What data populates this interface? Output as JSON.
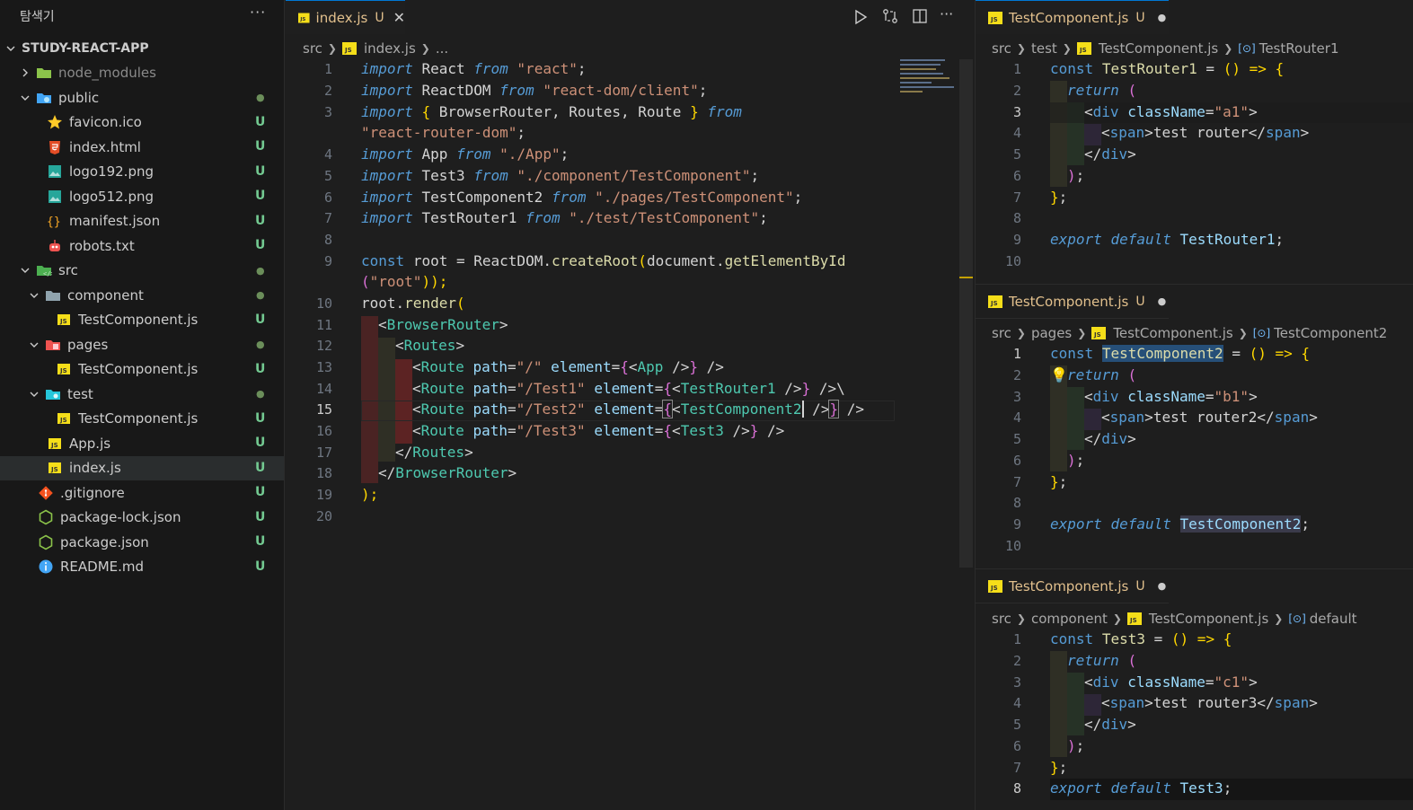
{
  "explorer": {
    "title": "탐색기",
    "more": "···",
    "project": "STUDY-REACT-APP",
    "items": [
      {
        "label": "node_modules",
        "status": ""
      },
      {
        "label": "public",
        "status": "●"
      },
      {
        "label": "favicon.ico",
        "status": "U"
      },
      {
        "label": "index.html",
        "status": "U"
      },
      {
        "label": "logo192.png",
        "status": "U"
      },
      {
        "label": "logo512.png",
        "status": "U"
      },
      {
        "label": "manifest.json",
        "status": "U"
      },
      {
        "label": "robots.txt",
        "status": "U"
      },
      {
        "label": "src",
        "status": "●"
      },
      {
        "label": "component",
        "status": "●"
      },
      {
        "label": "TestComponent.js",
        "status": "U"
      },
      {
        "label": "pages",
        "status": "●"
      },
      {
        "label": "TestComponent.js",
        "status": "U"
      },
      {
        "label": "test",
        "status": "●"
      },
      {
        "label": "TestComponent.js",
        "status": "U"
      },
      {
        "label": "App.js",
        "status": "U"
      },
      {
        "label": "index.js",
        "status": "U"
      },
      {
        "label": ".gitignore",
        "status": "U"
      },
      {
        "label": "package-lock.json",
        "status": "U"
      },
      {
        "label": "package.json",
        "status": "U"
      },
      {
        "label": "README.md",
        "status": "U"
      }
    ]
  },
  "main_editor": {
    "tab": {
      "label": "index.js",
      "status": "U",
      "close": "✕"
    },
    "breadcrumb": {
      "seg1": "src",
      "seg2": "index.js",
      "seg3": "..."
    },
    "line_numbers": [
      "1",
      "2",
      "3",
      "",
      "4",
      "5",
      "6",
      "7",
      "8",
      "9",
      "",
      "10",
      "11",
      "12",
      "13",
      "14",
      "15",
      "16",
      "17",
      "18",
      "19",
      "20"
    ],
    "current_line": "15"
  },
  "right_editors": [
    {
      "tab": {
        "label": "TestComponent.js",
        "status": "U",
        "dot": "●"
      },
      "breadcrumb": {
        "seg1": "src",
        "seg2": "test",
        "seg3": "TestComponent.js",
        "seg4": "TestRouter1"
      },
      "line_numbers": [
        "1",
        "2",
        "3",
        "4",
        "5",
        "6",
        "7",
        "8",
        "9",
        "10"
      ],
      "current_line": "3"
    },
    {
      "tab": {
        "label": "TestComponent.js",
        "status": "U",
        "dot": "●"
      },
      "breadcrumb": {
        "seg1": "src",
        "seg2": "pages",
        "seg3": "TestComponent.js",
        "seg4": "TestComponent2"
      },
      "line_numbers": [
        "1",
        "2",
        "3",
        "4",
        "5",
        "6",
        "7",
        "8",
        "9",
        "10"
      ],
      "current_line": "1"
    },
    {
      "tab": {
        "label": "TestComponent.js",
        "status": "U",
        "dot": "●"
      },
      "breadcrumb": {
        "seg1": "src",
        "seg2": "component",
        "seg3": "TestComponent.js",
        "seg4": "default"
      },
      "line_numbers": [
        "1",
        "2",
        "3",
        "4",
        "5",
        "6",
        "7",
        "8"
      ],
      "current_line": "8"
    }
  ],
  "code": {
    "main": [
      {
        "k": "import",
        "v": "React",
        "from": "from",
        "s": "\"react\"",
        "end": ";"
      },
      {
        "k": "import",
        "v": "ReactDOM",
        "from": "from",
        "s": "\"react-dom/client\"",
        "end": ";"
      },
      {
        "k": "import",
        "brace_open": "{",
        "v": "BrowserRouter, Routes, Route",
        "brace_close": "}",
        "from": "from"
      },
      {
        "s": "\"react-router-dom\"",
        "end": ";"
      },
      {
        "k": "import",
        "v": "App",
        "from": "from",
        "s": "\"./App\"",
        "end": ";"
      },
      {
        "k": "import",
        "v": "Test3",
        "from": "from",
        "s": "\"./component/TestComponent\"",
        "end": ";"
      },
      {
        "k": "import",
        "v": "TestComponent2",
        "from": "from",
        "s": "\"./pages/TestComponent\"",
        "end": ";"
      },
      {
        "k": "import",
        "v": "TestRouter1",
        "from": "from",
        "s": "\"./test/TestComponent\"",
        "end": ";"
      },
      {
        "kw": "const",
        "v": "root",
        "eq": "=",
        "obj": "ReactDOM",
        "fn": "createRoot",
        "p": "(",
        "arg": "document",
        "fn2": "getElementById"
      },
      {
        "p": "(",
        "s": "\"root\"",
        "end": "));"
      },
      {
        "obj": "root",
        "fn": "render",
        "p": "("
      },
      {
        "tag": "BrowserRouter"
      },
      {
        "tag": "Routes"
      },
      {
        "path": "\"/\"",
        "el": "App"
      },
      {
        "path": "\"/Test1\"",
        "el": "TestRouter1"
      },
      {
        "path": "\"/Test2\"",
        "el": "TestComponent2"
      },
      {
        "path": "\"/Test3\"",
        "el": "Test3"
      },
      {
        "close": "Routes"
      },
      {
        "close": "BrowserRouter"
      },
      {
        "end": ");"
      }
    ],
    "r1": {
      "name": "TestRouter1",
      "cls": "\"a1\"",
      "text": "test router"
    },
    "r2": {
      "name": "TestComponent2",
      "cls": "\"b1\"",
      "text": "test router2"
    },
    "r3": {
      "name": "Test3",
      "cls": "\"c1\"",
      "text": "test router3"
    },
    "tokens": {
      "const": "const",
      "return": "return",
      "div": "div",
      "span": "span",
      "className": "className",
      "export": "export",
      "default": "default",
      "arrow": "() => {",
      "Route": "Route",
      "path": "path",
      "element": "element"
    }
  },
  "colors": {
    "accent": "#0078d4",
    "git_untracked": "#73c991",
    "tab_modified": "#e2c08d"
  }
}
